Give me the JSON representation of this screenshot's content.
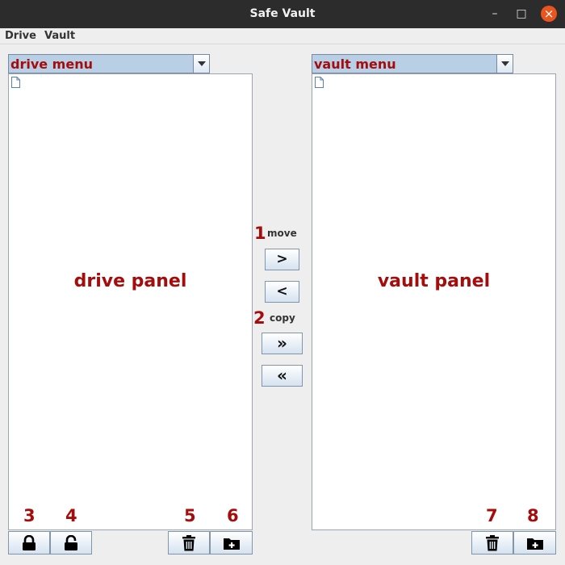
{
  "window": {
    "title": "Safe Vault",
    "minimize_glyph": "–",
    "maximize_glyph": "□",
    "close_glyph": "×"
  },
  "menubar": {
    "drive": "Drive",
    "vault": "Vault"
  },
  "drive": {
    "menu": "drive menu",
    "panel_label": "drive panel"
  },
  "vault": {
    "menu": "vault menu",
    "panel_label": "vault panel"
  },
  "center": {
    "move_number": "1",
    "move_label": "move",
    "move_right": ">",
    "move_left": "<",
    "copy_number": "2",
    "copy_label": "copy",
    "copy_right": "»",
    "copy_left": "«"
  },
  "drive_toolbar": {
    "lock_number": "3",
    "unlock_number": "4",
    "delete_number": "5",
    "new_folder_number": "6"
  },
  "vault_toolbar": {
    "delete_number": "7",
    "new_folder_number": "8"
  },
  "colors": {
    "annotation": "#a50c0c",
    "titlebar": "#2c2c2c",
    "close": "#e9541f"
  }
}
